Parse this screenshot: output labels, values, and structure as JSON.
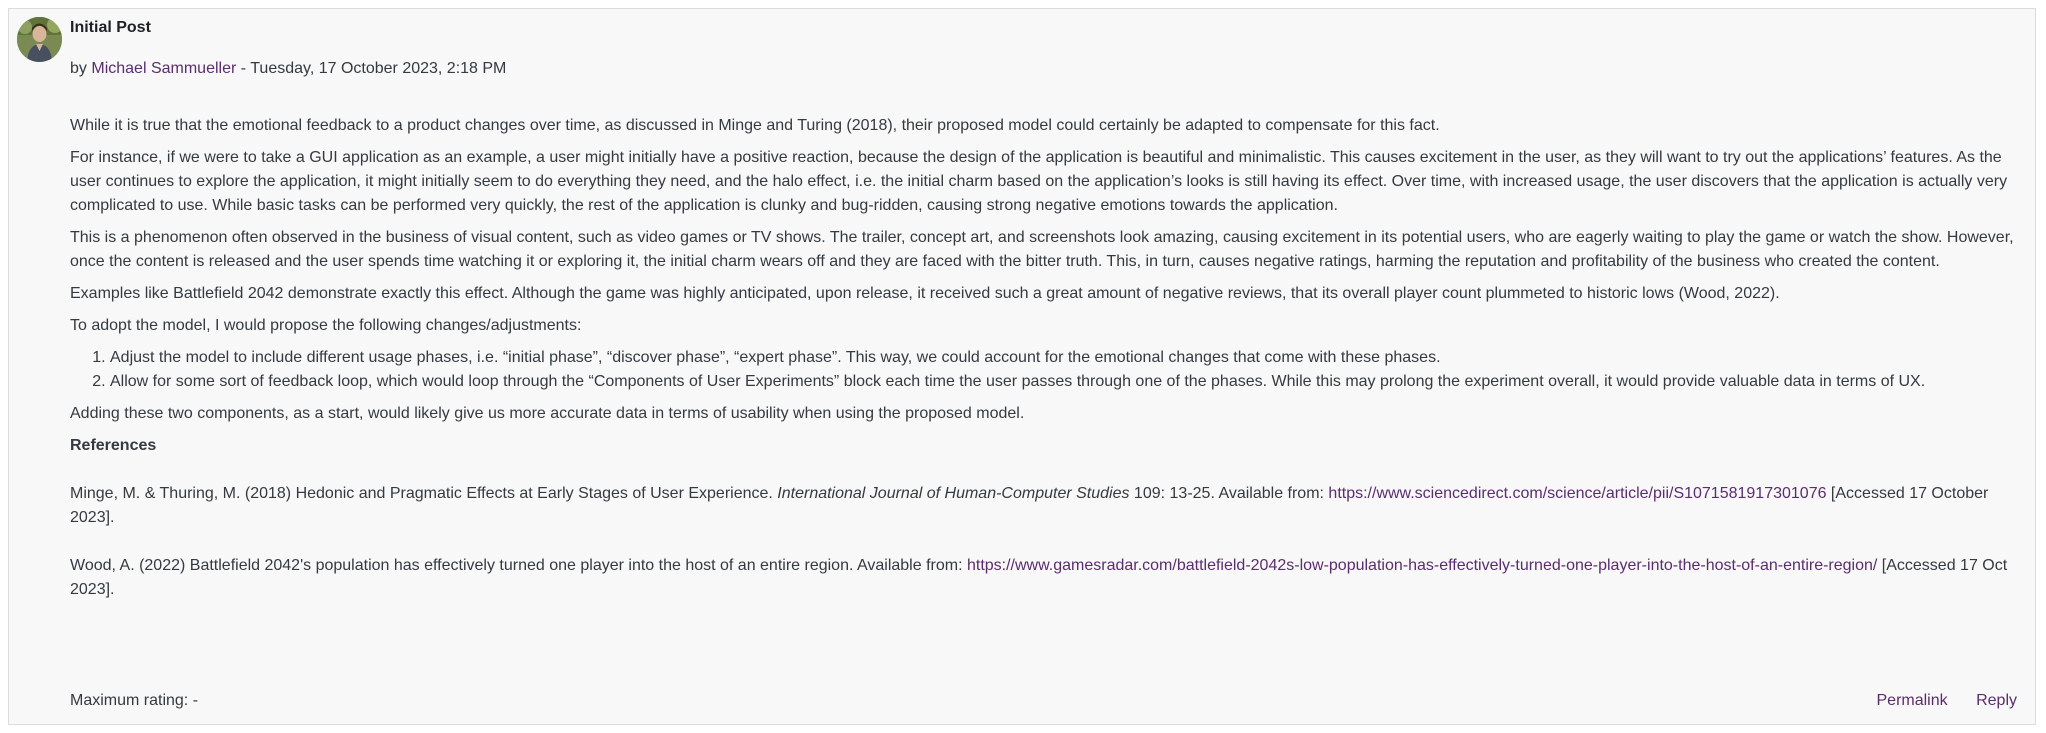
{
  "post": {
    "subject": "Initial Post",
    "by_prefix": "by",
    "author": "Michael Sammueller",
    "date": "- Tuesday, 17 October 2023, 2:18 PM",
    "paragraphs": [
      "While it is true that the emotional feedback to a product changes over time, as discussed in Minge and Turing (2018), their proposed model could certainly be adapted to compensate for this fact.",
      "For instance, if we were to take a GUI application as an example, a user might initially have a positive reaction, because the design of the application is beautiful and minimalistic. This causes excitement in the user, as they will want to try out the applications’ features. As the user continues to explore the application, it might initially seem to do everything they need, and the halo effect, i.e. the initial charm based on the application’s looks is still having its effect. Over time, with increased usage, the user discovers that the application is actually very complicated to use. While basic tasks can be performed very quickly, the rest of the application is clunky and bug-ridden, causing strong negative emotions towards the application.",
      "This is a phenomenon often observed in the business of visual content, such as video games or TV shows. The trailer, concept art, and screenshots look amazing, causing excitement in its potential users, who are eagerly waiting to play the game or watch the show. However, once the content is released and the user spends time watching it or exploring it, the initial charm wears off and they are faced with the bitter truth. This, in turn, causes negative ratings, harming the reputation and profitability of the business who created the content.",
      "Examples like Battlefield 2042 demonstrate exactly this effect. Although the game was highly anticipated, upon release, it received such a great amount of negative reviews, that its overall player count plummeted to historic lows (Wood, 2022).",
      "To adopt the model, I would propose the following changes/adjustments:"
    ],
    "list_items": [
      "Adjust the model to include different usage phases, i.e. “initial phase”, “discover phase”, “expert phase”. This way, we could account for the emotional changes that come with these phases.",
      "Allow for some sort of feedback loop, which would loop through the “Components of User Experiments” block each time the user passes through one of the phases. While this may prolong the experiment overall, it would provide valuable data in terms of UX."
    ],
    "closing": "Adding these two components, as a start, would likely give us more accurate data in terms of usability when using the proposed model.",
    "references_heading": "References",
    "references": [
      {
        "text_before": "Minge, M. & Thuring, M. (2018) Hedonic and Pragmatic Effects at Early Stages of User Experience. ",
        "journal": "International Journal of Human-Computer Studies",
        "text_middle": " 109: 13-25. Available from: ",
        "url": "https://www.sciencedirect.com/science/article/pii/S1071581917301076",
        "text_after": " [Accessed 17 October 2023]."
      },
      {
        "text_before": "Wood, A. (2022) Battlefield 2042's population has effectively turned one player into the host of an entire region. Available from: ",
        "journal": "",
        "text_middle": "",
        "url": "https://www.gamesradar.com/battlefield-2042s-low-population-has-effectively-turned-one-player-into-the-host-of-an-entire-region/",
        "text_after": " [Accessed 17 Oct 2023]."
      }
    ],
    "rating": "Maximum rating: -",
    "permalink_label": "Permalink",
    "reply_label": "Reply"
  },
  "colors": {
    "link": "#5b2d6e",
    "text": "#343a40",
    "background": "#f8f8f8",
    "border": "#dcdcdc"
  },
  "icons": {
    "avatar": "user-avatar-photo"
  }
}
